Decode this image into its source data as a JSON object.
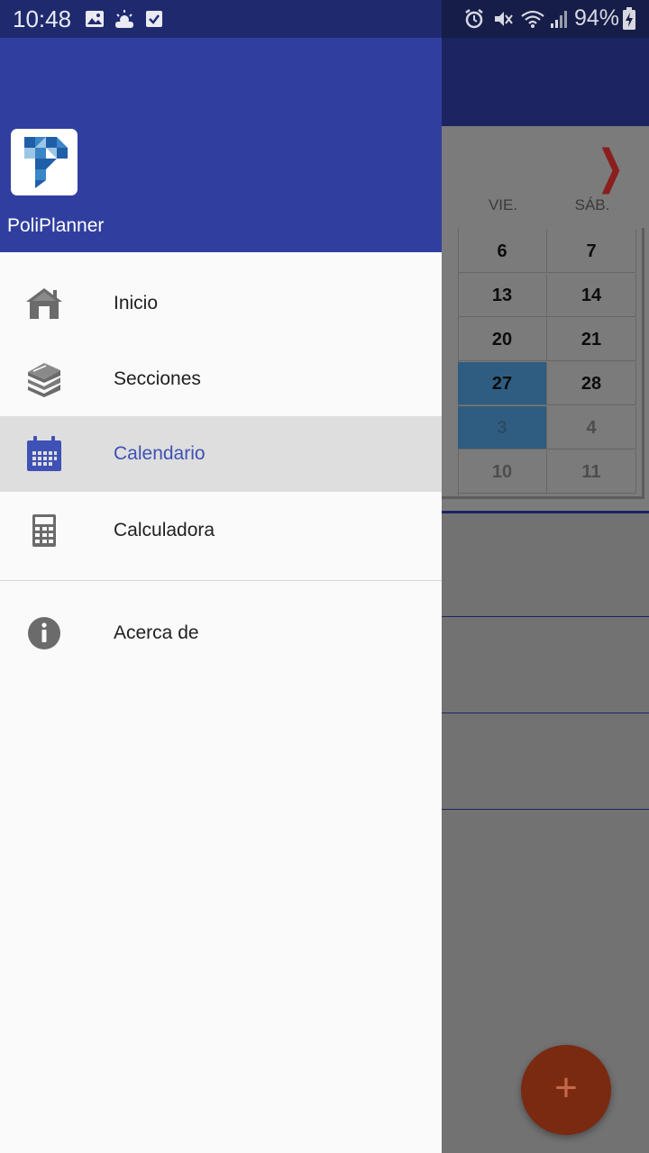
{
  "status_bar": {
    "time": "10:48",
    "battery": "94%",
    "left_icons": [
      "image-icon",
      "weather-icon",
      "checkbox-icon"
    ],
    "right_icons": [
      "alarm-icon",
      "mute-icon",
      "wifi-icon",
      "signal-icon",
      "battery-charging-icon"
    ]
  },
  "drawer": {
    "app_name": "PoliPlanner",
    "menu": [
      {
        "label": "Inicio",
        "icon": "home-icon",
        "active": false
      },
      {
        "label": "Secciones",
        "icon": "books-icon",
        "active": false
      },
      {
        "label": "Calendario",
        "icon": "calendar-icon",
        "active": true
      },
      {
        "label": "Calculadora",
        "icon": "calculator-icon",
        "active": false
      }
    ],
    "secondary": [
      {
        "label": "Acerca de",
        "icon": "info-icon"
      }
    ]
  },
  "background": {
    "calendar": {
      "day_headers": [
        "VIE.",
        "SÁB."
      ],
      "rows": [
        [
          "6",
          "7"
        ],
        [
          "13",
          "14"
        ],
        [
          "20",
          "21"
        ],
        [
          "27",
          "28"
        ],
        [
          "3",
          "4"
        ],
        [
          "10",
          "11"
        ]
      ]
    },
    "fab_label": "+"
  },
  "colors": {
    "primary": "#303f9f",
    "primary_dark": "#1f2a6e",
    "accent_active_text": "#3f51b5",
    "selected_day": "#2f5d82"
  }
}
